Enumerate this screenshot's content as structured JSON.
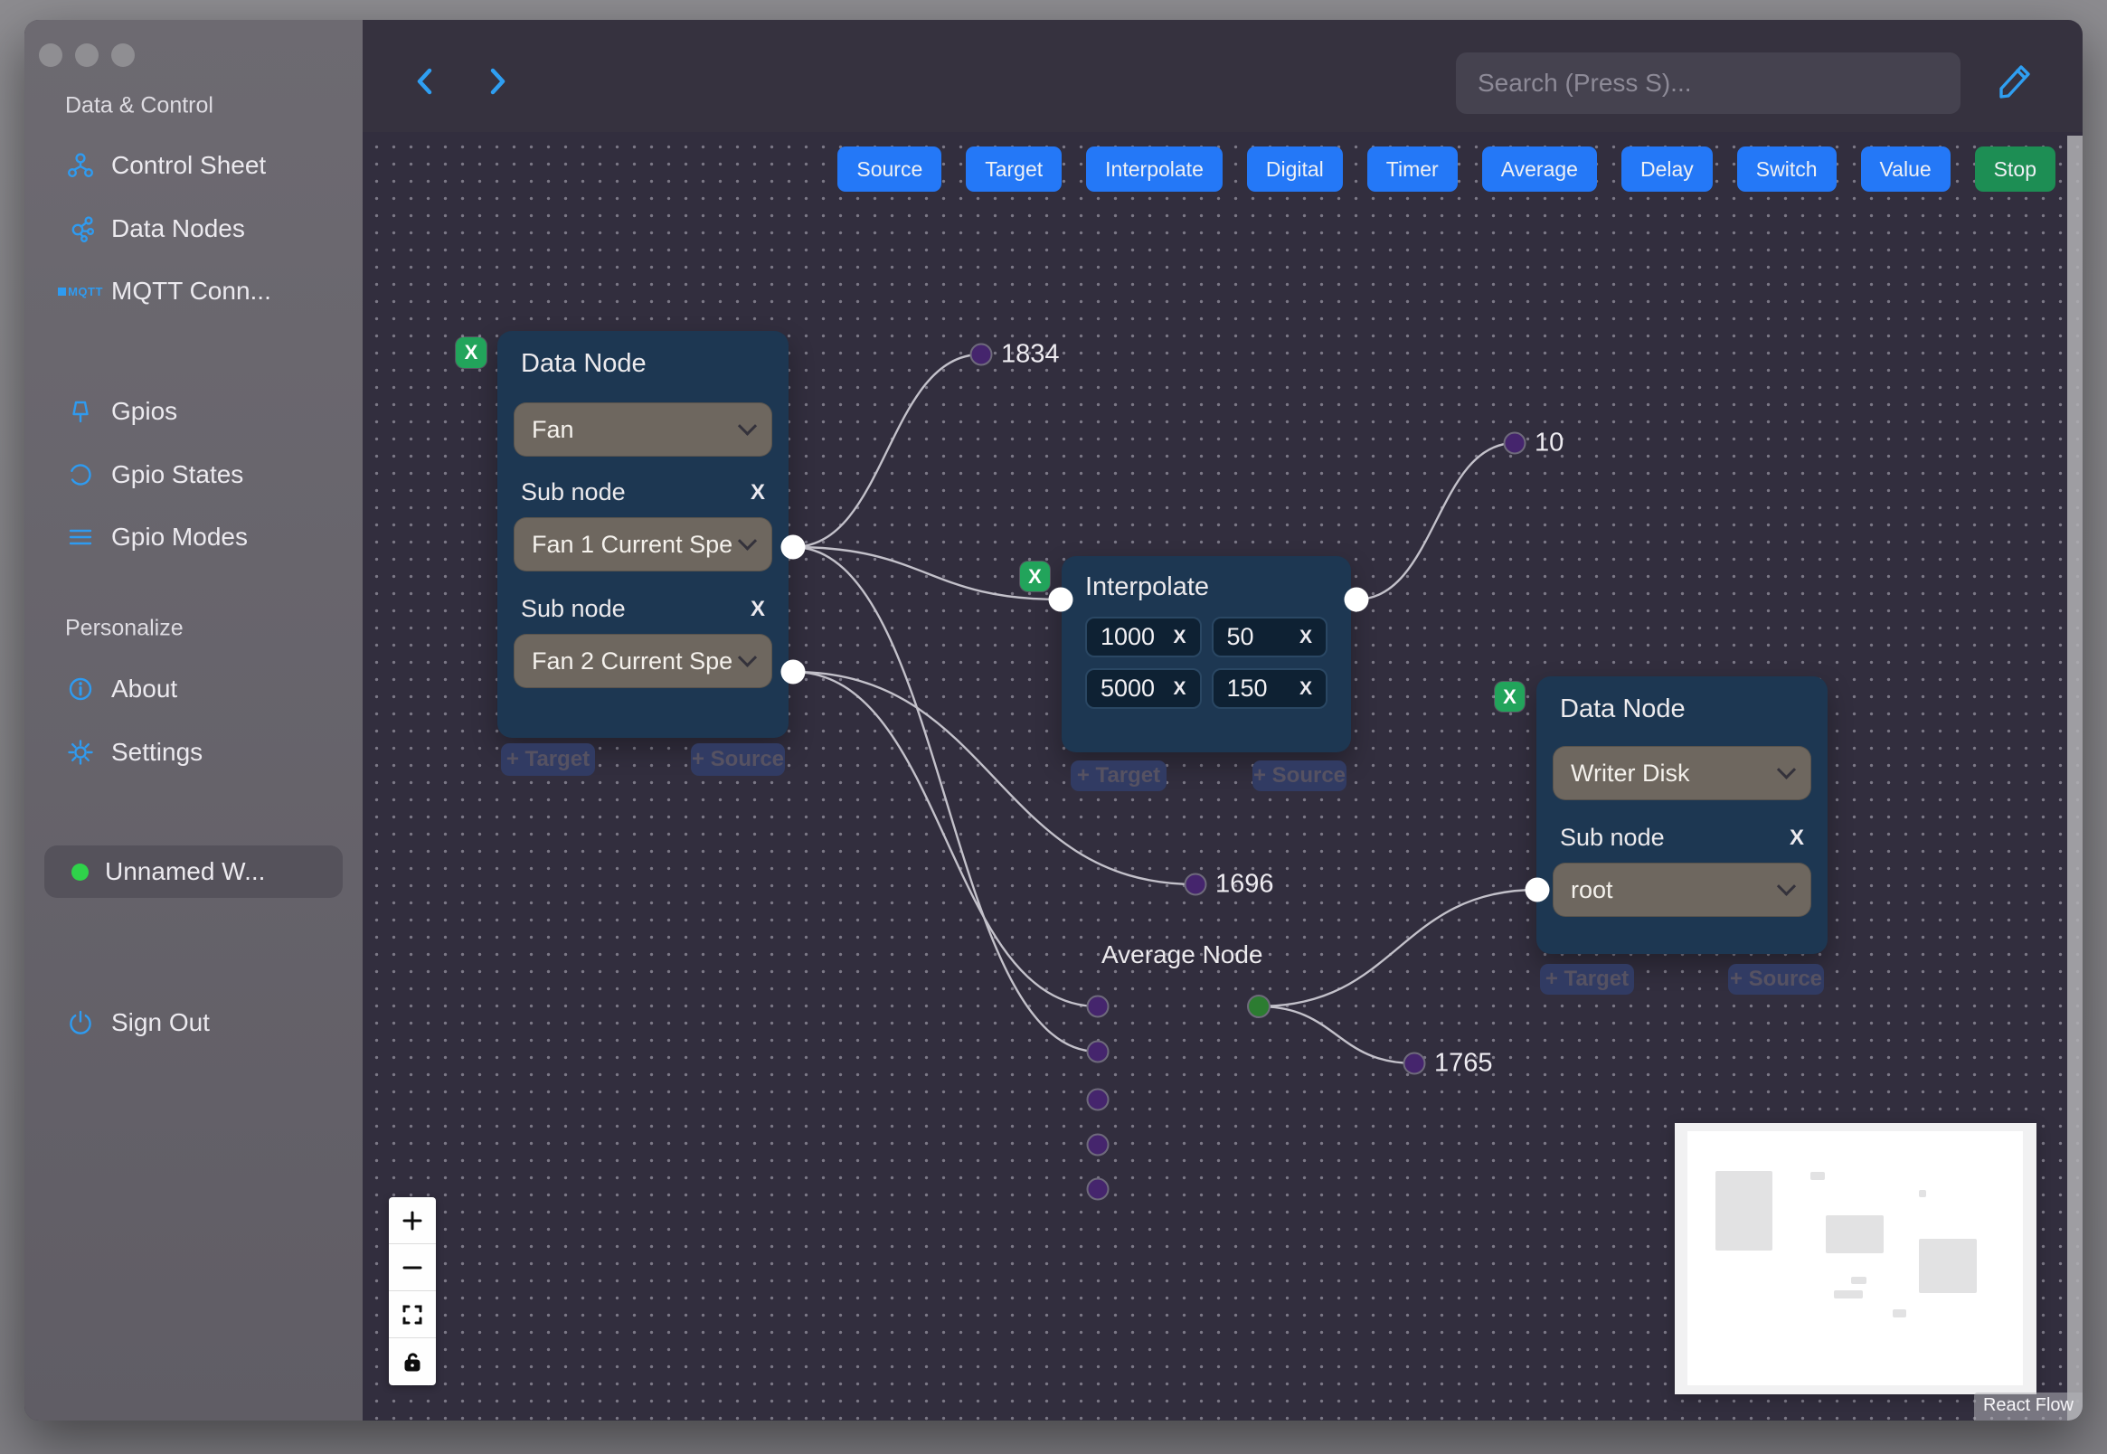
{
  "colors": {
    "accent_blue": "#2478f7",
    "stop_green": "#1d8e54",
    "icon_blue": "#2f9bf0",
    "node_bg": "#1d3752",
    "handle_purple": "#45256d",
    "handle_green": "#2c7c31",
    "workflow_status_green": "#2fd24a",
    "canvas_bg": "#322e3e"
  },
  "sidebar": {
    "section1_label": "Data & Control",
    "items": [
      {
        "label": "Control Sheet"
      },
      {
        "label": "Data Nodes"
      },
      {
        "label": "MQTT Conn..."
      },
      {
        "label": "Gpios"
      },
      {
        "label": "Gpio States"
      },
      {
        "label": "Gpio Modes"
      },
      {
        "label": "About"
      },
      {
        "label": "Settings"
      }
    ],
    "section2_label": "Personalize",
    "workflow": {
      "label": "Unnamed W..."
    },
    "signout_label": "Sign Out"
  },
  "topbar": {
    "search_placeholder": "Search (Press S)..."
  },
  "toolbar": {
    "buttons": [
      {
        "label": "Source"
      },
      {
        "label": "Target"
      },
      {
        "label": "Interpolate"
      },
      {
        "label": "Digital"
      },
      {
        "label": "Timer"
      },
      {
        "label": "Average"
      },
      {
        "label": "Delay"
      },
      {
        "label": "Switch"
      },
      {
        "label": "Value"
      },
      {
        "label": "Stop"
      }
    ]
  },
  "canvas": {
    "nodes": {
      "fan": {
        "title": "Data Node",
        "select_value": "Fan",
        "sub_label": "Sub node",
        "sub1_value": "Fan 1 Current Spe",
        "sub2_value": "Fan 2 Current Spe",
        "remove_label": "X",
        "delete_label": "X",
        "add_target": "+ Target",
        "add_source": "+ Source"
      },
      "interpolate": {
        "title": "Interpolate",
        "values": [
          {
            "v": "1000"
          },
          {
            "v": "50"
          },
          {
            "v": "5000"
          },
          {
            "v": "150"
          }
        ],
        "remove_label": "X",
        "delete_label": "X",
        "add_target": "+ Target",
        "add_source": "+ Source"
      },
      "writer": {
        "title": "Data Node",
        "select_value": "Writer Disk",
        "sub_label": "Sub node",
        "sub_value": "root",
        "remove_label": "X",
        "delete_label": "X",
        "add_target": "+ Target",
        "add_source": "+ Source"
      },
      "average": {
        "title": "Average Node"
      }
    },
    "edge_labels": [
      {
        "value": "1834"
      },
      {
        "value": "10"
      },
      {
        "value": "1696"
      },
      {
        "value": "1765"
      }
    ],
    "attribution": "React Flow"
  }
}
